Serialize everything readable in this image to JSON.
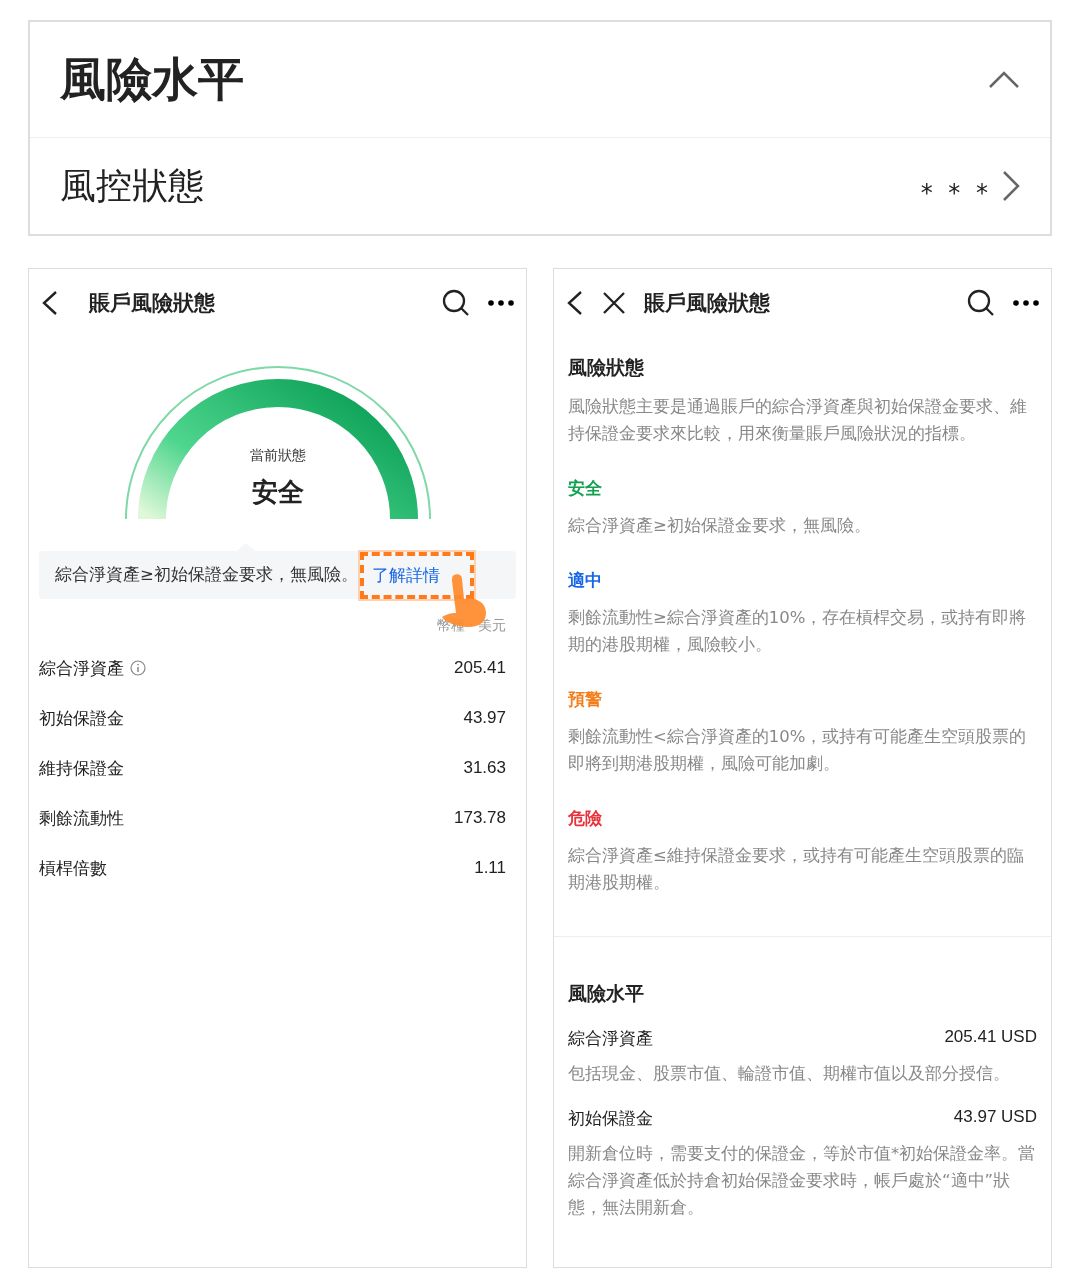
{
  "summary_card": {
    "title": "風險水平",
    "expanded": true,
    "status_row": {
      "label": "風控狀態",
      "value": "* * *"
    }
  },
  "account_screen": {
    "title": "賬戶風險狀態",
    "gauge": {
      "caption": "當前狀態",
      "status": "安全"
    },
    "tip": {
      "text": "綜合淨資產≥初始保證金要求，無風險。",
      "link": "了解詳情"
    },
    "currency": "幣種 · 美元",
    "metrics": [
      {
        "label": "綜合淨資產",
        "info": true,
        "value": "205.41"
      },
      {
        "label": "初始保證金",
        "info": false,
        "value": "43.97"
      },
      {
        "label": "維持保證金",
        "info": false,
        "value": "31.63"
      },
      {
        "label": "剩餘流動性",
        "info": false,
        "value": "173.78"
      },
      {
        "label": "槓桿倍數",
        "info": false,
        "value": "1.11"
      }
    ]
  },
  "detail_screen": {
    "title": "賬戶風險狀態",
    "intro": {
      "heading": "風險狀態",
      "text": "風險狀態主要是通過賬戶的綜合淨資產與初始保證金要求、維持保證金要求來比較，用來衡量賬戶風險狀況的指標。"
    },
    "statuses": [
      {
        "name": "安全",
        "color": "#12a150",
        "text": "綜合淨資產≥初始保證金要求，無風險。"
      },
      {
        "name": "適中",
        "color": "#1766e6",
        "text": "剩餘流動性≥綜合淨資產的10%，存在槓桿交易，或持有即將期的港股期權，風險較小。"
      },
      {
        "name": "預警",
        "color": "#f57c1a",
        "text": "剩餘流動性<綜合淨資產的10%，或持有可能產生空頭股票的即將到期港股期權，風險可能加劇。"
      },
      {
        "name": "危險",
        "color": "#e8323c",
        "text": "綜合淨資產≤維持保證金要求，或持有可能產生空頭股票的臨期港股期權。"
      }
    ],
    "level_section": {
      "heading": "風險水平",
      "items": [
        {
          "label": "綜合淨資產",
          "value": "205.41 USD",
          "text": "包括現金、股票市值、輪證市值、期權市值以及部分授信。"
        },
        {
          "label": "初始保證金",
          "value": "43.97 USD",
          "text": "開新倉位時，需要支付的保證金，等於市值*初始保證金率。當綜合淨資產低於持倉初始保證金要求時，帳戶處於“適中”狀態，無法開新倉。"
        }
      ]
    }
  }
}
